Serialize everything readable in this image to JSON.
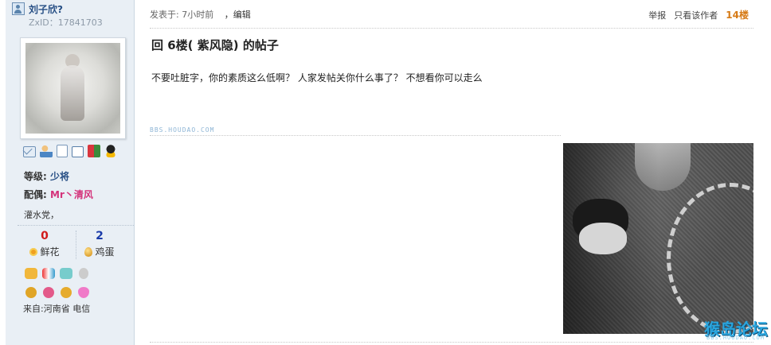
{
  "sidebar": {
    "username": "刘子欣?",
    "zxid": "ZxID：17841703",
    "level_label": "等级:",
    "level_value": "少将",
    "spouse_label": "配偶:",
    "spouse_value": "Mr丶清风",
    "motto": "灌水党，",
    "flowers_count": "0",
    "flowers_label": "鲜花",
    "eggs_count": "2",
    "eggs_label": "鸡蛋",
    "origin": "来自:河南省 电信",
    "actions": [
      "mail-icon",
      "add-friend-icon",
      "view-posts-icon",
      "profile-icon",
      "blocks-icon",
      "qq-icon"
    ]
  },
  "post": {
    "posted_time": "发表于: 7小时前",
    "edit_label": "，编辑",
    "report_label": "举报",
    "only_author_label": "只看该作者",
    "floor_label": "14楼",
    "title": "回 6楼(  紫风隐) 的帖子",
    "body": "不要吐脏字，你的素质这么低啊？  人家发帖关你什么事了？  不想看你可以走么",
    "watermark": "BBS.HOUDAO.COM",
    "logo_text": "猴岛论坛",
    "logo_sub": "BBS.HOUDAO.COM"
  },
  "colors": {
    "sidebar_bg": "#e9eff5",
    "username": "#274f85",
    "spouse": "#d4327a",
    "floor": "#d67a16",
    "flowers": "#d11a1a",
    "eggs": "#1a3ba9"
  }
}
